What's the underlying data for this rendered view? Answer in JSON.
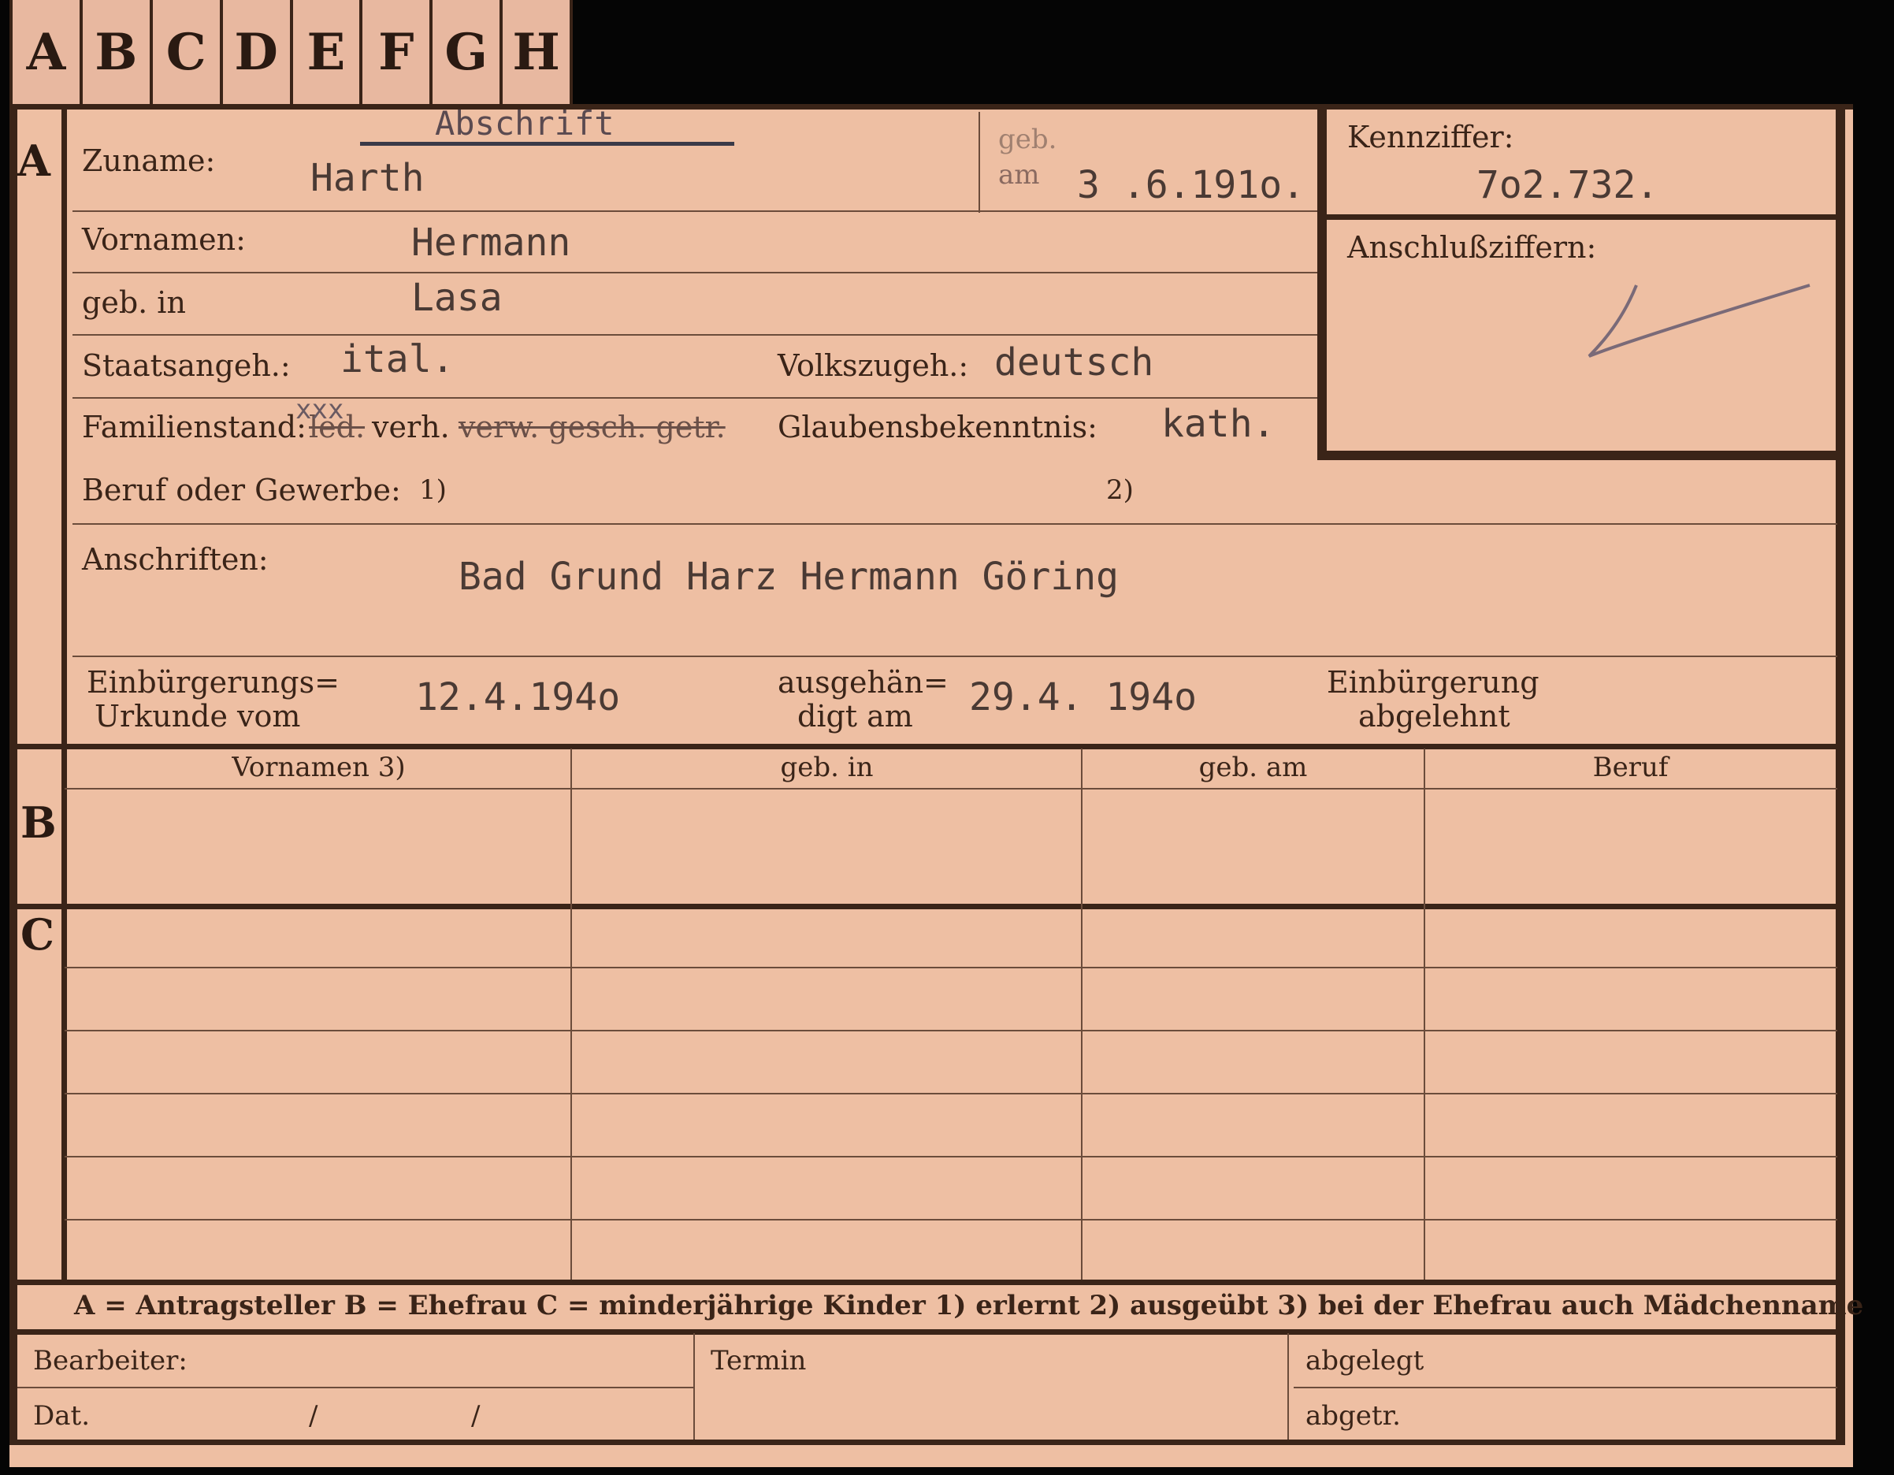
{
  "tabs": [
    "A",
    "B",
    "C",
    "D",
    "E",
    "F",
    "G",
    "H"
  ],
  "sections": {
    "a": "A",
    "b": "B",
    "c": "C"
  },
  "header": {
    "copy_stamp": "Abschrift",
    "surname_label": "Zuname:",
    "surname": "Harth",
    "born_on_label_1": "geb.",
    "born_on_label_2": "am",
    "birth_date": "3 .6.191o.",
    "id_label": "Kennziffer:",
    "id_number": "7o2.732.",
    "connection_label": "Anschlußziffern:"
  },
  "person": {
    "first_names_label": "Vornamen:",
    "first_names": "Hermann",
    "birthplace_label": "geb. in",
    "birthplace": "Lasa",
    "citizenship_label": "Staatsangeh.:",
    "citizenship": "ital.",
    "ethnicity_label": "Volkszugeh.:",
    "ethnicity": "deutsch",
    "marital_label": "Familienstand:",
    "marital_struck_1": "led.",
    "marital_struck_1_overlay": "xxx",
    "marital_option": "verh.",
    "marital_struck_2": "verw. gesch. getr.",
    "religion_label": "Glaubensbekenntnis:",
    "religion": "kath.",
    "occupation_label": "Beruf oder Gewerbe:",
    "occupation_note1": "1)",
    "occupation_note2": "2)",
    "address_label": "Anschriften:",
    "address": "Bad Grund Harz Hermann Göring"
  },
  "naturalization": {
    "cert_label_1": "Einbürgerungs=",
    "cert_label_2": "Urkunde vom",
    "cert_date": "12.4.194o",
    "handed_label_1": "ausgehän=",
    "handed_label_2": "digt am",
    "handed_date": "29.4. 194o",
    "rejected_label_1": "Einbürgerung",
    "rejected_label_2": "abgelehnt"
  },
  "family_table": {
    "columns": [
      "Vornamen 3)",
      "geb. in",
      "geb. am",
      "Beruf"
    ]
  },
  "legend": "A = Antragsteller   B = Ehefrau   C = minderjährige Kinder   1) erlernt   2) ausgeübt   3) bei der Ehefrau auch Mädchenname",
  "footer": {
    "clerk_label": "Bearbeiter:",
    "date_label": "Dat.",
    "date_sep": "/",
    "deadline_label": "Termin",
    "filed_label": "abgelegt",
    "separated_label": "abgetr."
  },
  "colors": {
    "card": "#eebfa3",
    "ink": "#3a2418",
    "background": "#050505"
  }
}
